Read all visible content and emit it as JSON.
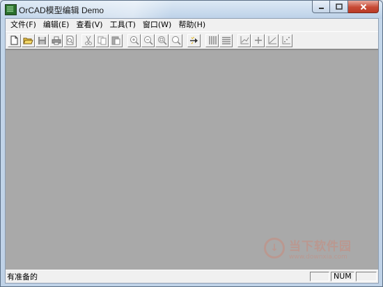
{
  "window": {
    "title": "OrCAD模型编辑 Demo"
  },
  "menu": [
    {
      "label": "文件(F)"
    },
    {
      "label": "编辑(E)"
    },
    {
      "label": "查看(V)"
    },
    {
      "label": "工具(T)"
    },
    {
      "label": "窗口(W)"
    },
    {
      "label": "帮助(H)"
    }
  ],
  "toolbar": {
    "buttons": [
      "new-document-icon",
      "open-folder-icon",
      "save-icon",
      "print-icon",
      "print-preview-icon",
      "cut-icon",
      "copy-icon",
      "paste-icon",
      "zoom-in-icon",
      "zoom-out-icon",
      "zoom-fit-icon",
      "zoom-area-icon",
      "run-icon",
      "vertical-bars-icon",
      "horizontal-bars-icon",
      "chart-edit-icon",
      "add-point-icon",
      "chart-line-icon",
      "chart-scatter-icon"
    ]
  },
  "status": {
    "text": "有准备的",
    "num": "NUM"
  },
  "watermark": {
    "name": "当下软件园",
    "url": "www.downxia.com"
  },
  "colors": {
    "workspace": "#a9a9a9",
    "chrome": "#f0f0f0",
    "close_button": "#c74a35"
  }
}
